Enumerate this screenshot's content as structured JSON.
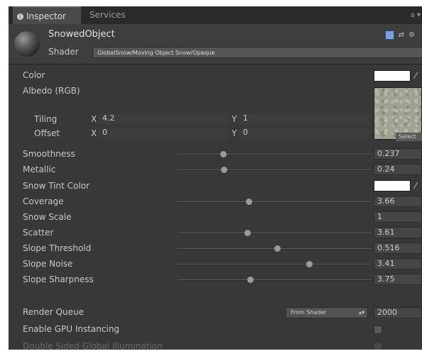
{
  "tabs": {
    "inspector": "Inspector",
    "services": "Services",
    "lock_menu": "a ▾"
  },
  "header": {
    "object_name": "SnowedObject",
    "shader_label": "Shader",
    "shader_value": "GlobalSnow/Moving Object Snow/Opaque"
  },
  "properties": {
    "color_label": "Color",
    "albedo_label": "Albedo (RGB)",
    "albedo_button": "Select",
    "tiling_label": "Tiling",
    "offset_label": "Offset",
    "x_label": "X",
    "y_label": "Y",
    "tiling_x": "4.2",
    "tiling_y": "1",
    "offset_x": "0",
    "offset_y": "0",
    "snow_tint_label": "Snow Tint Color"
  },
  "sliders": [
    {
      "label": "Smoothness",
      "value": "0.237",
      "fraction": 0.237
    },
    {
      "label": "Metallic",
      "value": "0.24",
      "fraction": 0.24
    },
    {
      "label": "Coverage",
      "value": "3.66",
      "fraction": 0.366
    },
    {
      "label": "Snow Scale",
      "value": "1",
      "fraction": null
    },
    {
      "label": "Scatter",
      "value": "3.61",
      "fraction": 0.361
    },
    {
      "label": "Slope Threshold",
      "value": "0.516",
      "fraction": 0.516
    },
    {
      "label": "Slope Noise",
      "value": "3.41",
      "fraction": 0.68
    },
    {
      "label": "Slope Sharpness",
      "value": "3.75",
      "fraction": 0.375
    }
  ],
  "footer": {
    "render_queue_label": "Render Queue",
    "render_queue_mode": "From Shader",
    "render_queue_value": "2000",
    "gpu_instancing_label": "Enable GPU Instancing",
    "double_sided_gi_label": "Double Sided Global Illumination"
  },
  "colors": {
    "background": "#383838",
    "header": "#3e3e3e",
    "swatch": "#ffffff"
  }
}
